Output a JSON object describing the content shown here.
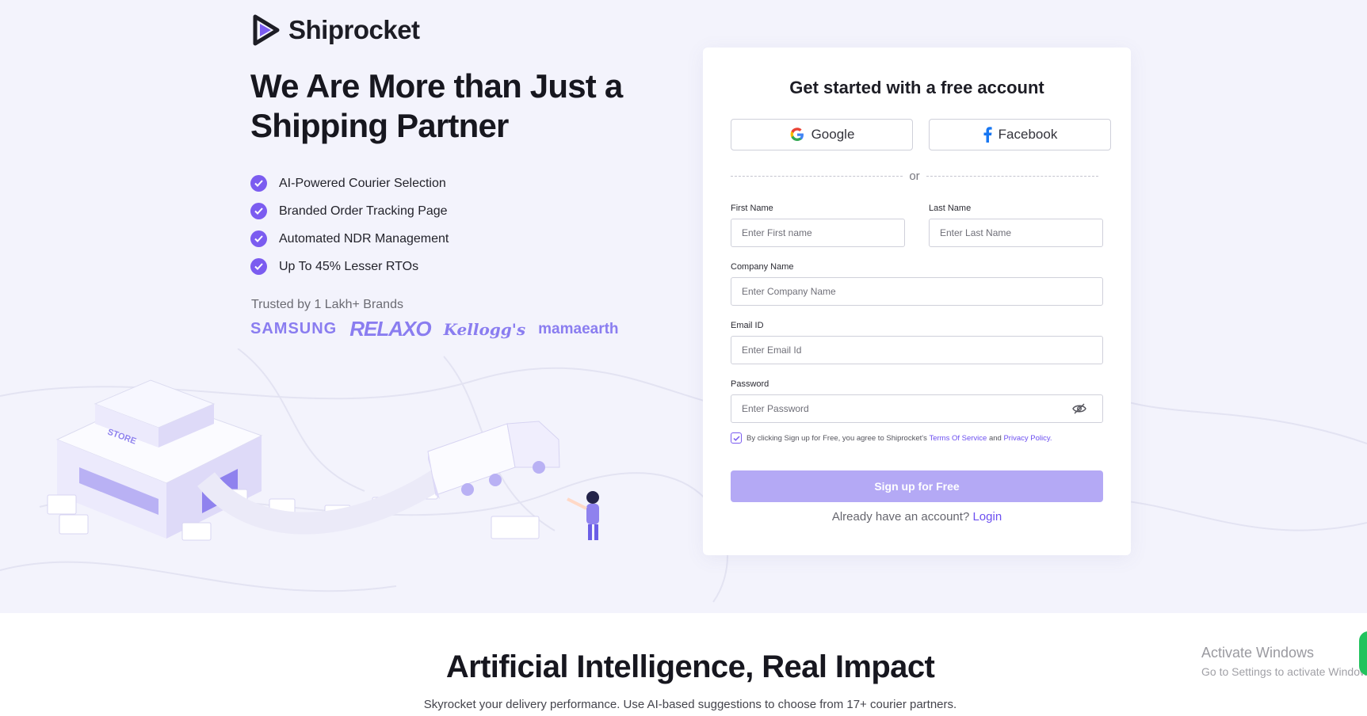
{
  "brand": {
    "name": "Shiprocket"
  },
  "hero": {
    "headline": "We Are More than Just a Shipping Partner",
    "features": [
      "AI-Powered Courier Selection",
      "Branded Order Tracking Page",
      "Automated NDR Management",
      "Up To 45% Lesser RTOs"
    ],
    "trusted_label": "Trusted by 1 Lakh+ Brands",
    "brands": [
      "SAMSUNG",
      "RELAXO",
      "Kellogg's",
      "mamaearth"
    ],
    "store_sign": "STORE"
  },
  "signup": {
    "title": "Get started with a free account",
    "google_label": "Google",
    "facebook_label": "Facebook",
    "divider_text": "or",
    "first_name": {
      "label": "First Name",
      "placeholder": "Enter First name"
    },
    "last_name": {
      "label": "Last Name",
      "placeholder": "Enter Last Name"
    },
    "company": {
      "label": "Company Name",
      "placeholder": "Enter Company Name"
    },
    "email": {
      "label": "Email ID",
      "placeholder": "Enter Email Id"
    },
    "password": {
      "label": "Password",
      "placeholder": "Enter Password"
    },
    "consent": {
      "prefix": "By clicking Sign up for Free, you agree to Shiprocket's",
      "terms": "Terms Of Service",
      "and": "and",
      "privacy": "Privacy Policy."
    },
    "submit_label": "Sign up for Free",
    "login_prompt": "Already have an account?",
    "login_link": "Login"
  },
  "section": {
    "title": "Artificial Intelligence, Real Impact",
    "subtitle": "Skyrocket your delivery performance. Use AI-based suggestions to choose from 17+ courier partners."
  },
  "windows_watermark": {
    "title": "Activate Windows",
    "subtitle": "Go to Settings to activate Windows."
  },
  "colors": {
    "accent": "#7b5cf0",
    "hero_bg": "#f3f3fc",
    "button_disabled": "#b4a9f5",
    "brand_logos": "#8a7df0"
  }
}
